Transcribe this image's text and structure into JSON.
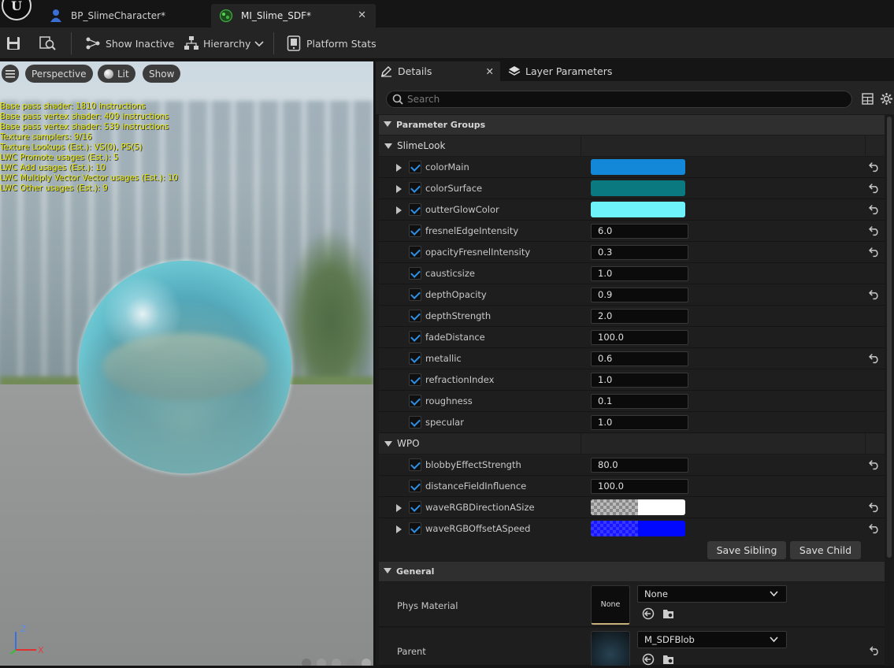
{
  "tabs": [
    {
      "label": "BP_SlimeCharacter*",
      "icon": "blueprint-person-icon"
    },
    {
      "label": "MI_Slime_SDF*",
      "icon": "material-instance-icon",
      "close": "✕"
    }
  ],
  "toolbar": {
    "show_inactive": "Show Inactive",
    "hierarchy": "Hierarchy",
    "platform_stats": "Platform Stats"
  },
  "viewport": {
    "perspective": "Perspective",
    "lit": "Lit",
    "show": "Show",
    "stats": [
      "Base pass shader: 1810 instructions",
      "Base pass vertex shader: 409 instructions",
      "Base pass vertex shader: 539 instructions",
      "Texture samplers: 9/16",
      "Texture Lookups (Est.): VS(0), PS(5)",
      "LWC Promote usages (Est.): 5",
      "LWC Add usages (Est.): 10",
      "LWC Multiply Vector Vector usages (Est.): 10",
      "LWC Other usages (Est.): 9"
    ],
    "axis_z": "Z",
    "axis_x": "X"
  },
  "details": {
    "tab_details": "Details",
    "tab_close": "✕",
    "tab_layers": "Layer Parameters",
    "search_placeholder": "Search",
    "parameter_groups": "Parameter Groups",
    "slime_look": "SlimeLook",
    "wpo": "WPO",
    "general": "General",
    "save_sibling": "Save Sibling",
    "save_child": "Save Child",
    "phys_material_label": "Phys Material",
    "phys_material_thumb": "None",
    "phys_material_value": "None",
    "parent_label": "Parent",
    "parent_value": "M_SDFBlob"
  },
  "slime_params": [
    {
      "name": "colorMain",
      "type": "color",
      "color": "#1488d8",
      "expandable": true,
      "reset": true
    },
    {
      "name": "colorSurface",
      "type": "color",
      "color": "#0a7a80",
      "expandable": true,
      "reset": true
    },
    {
      "name": "outterGlowColor",
      "type": "color",
      "color": "#6ff3fb",
      "expandable": true,
      "reset": true
    },
    {
      "name": "fresnelEdgeIntensity",
      "type": "num",
      "value": "6.0",
      "reset": true
    },
    {
      "name": "opacityFresnelIntensity",
      "type": "num",
      "value": "0.3",
      "reset": true
    },
    {
      "name": "causticsize",
      "type": "num",
      "value": "1.0",
      "reset": false
    },
    {
      "name": "depthOpacity",
      "type": "num",
      "value": "0.9",
      "reset": true
    },
    {
      "name": "depthStrength",
      "type": "num",
      "value": "2.0",
      "reset": false
    },
    {
      "name": "fadeDistance",
      "type": "num",
      "value": "100.0",
      "reset": false
    },
    {
      "name": "metallic",
      "type": "num",
      "value": "0.6",
      "reset": true
    },
    {
      "name": "refractionIndex",
      "type": "num",
      "value": "1.0",
      "reset": false
    },
    {
      "name": "roughness",
      "type": "num",
      "value": "0.1",
      "reset": false
    },
    {
      "name": "specular",
      "type": "num",
      "value": "1.0",
      "reset": false
    }
  ],
  "wpo_params": [
    {
      "name": "blobbyEffectStrength",
      "type": "num",
      "value": "80.0",
      "reset": true
    },
    {
      "name": "distanceFieldInfluence",
      "type": "num",
      "value": "100.0",
      "reset": false
    },
    {
      "name": "waveRGBDirectionASize",
      "type": "alpha-white",
      "expandable": true,
      "reset": true
    },
    {
      "name": "waveRGBOffsetASpeed",
      "type": "alpha-blue",
      "expandable": true,
      "reset": true
    }
  ]
}
